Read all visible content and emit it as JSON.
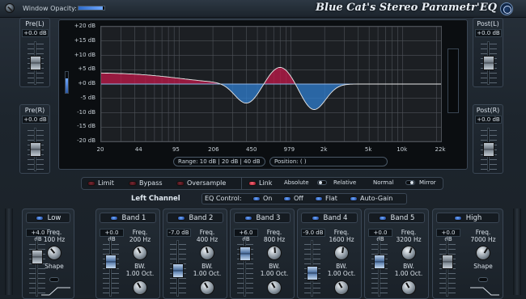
{
  "header": {
    "window_opacity_label": "Window Opacity:",
    "window_opacity_value": 0.95,
    "app_title": "Blue Cat's Stereo Parametr'EQ"
  },
  "pre_l": {
    "title": "Pre(L)",
    "value": "+0.0 dB"
  },
  "pre_r": {
    "title": "Pre(R)",
    "value": "+0.0 dB"
  },
  "post_l": {
    "title": "Post(L)",
    "value": "+0.0 dB"
  },
  "post_r": {
    "title": "Post(R)",
    "value": "+0.0 dB"
  },
  "graph": {
    "y_labels": [
      "+20 dB",
      "+15 dB",
      "+10 dB",
      "+5 dB",
      "+0 dB",
      "-5 dB",
      "-10 dB",
      "-15 dB",
      "-20 dB"
    ],
    "x_labels": [
      "20",
      "44",
      "95",
      "206",
      "450",
      "979",
      "2k",
      "5k",
      "10k",
      "22k"
    ],
    "range_prefix": "Range:",
    "range_options": [
      "10 dB",
      "20 dB",
      "40 dB"
    ],
    "range_text": "Range:  10 dB  |  20 dB  |  40 dB",
    "position_label": "Position:",
    "position_value": "(                              )"
  },
  "options": {
    "limit": "Limit",
    "bypass": "Bypass",
    "oversample": "Oversample",
    "link": "Link",
    "absolute": "Absolute",
    "relative": "Relative",
    "normal": "Normal",
    "mirror": "Mirror"
  },
  "channel": {
    "label": "Left Channel",
    "eq_control_label": "EQ Control:",
    "on": "On",
    "off": "Off",
    "flat": "Flat",
    "auto_gain": "Auto-Gain"
  },
  "bands": [
    {
      "name": "Low",
      "gain": "+4.0 dB",
      "freq_label": "Freq.",
      "freq": "100 Hz",
      "param_label": "Shape",
      "param": ""
    },
    {
      "name": "Band 1",
      "gain": "+0.0 dB",
      "freq_label": "Freq.",
      "freq": "200 Hz",
      "param_label": "BW.",
      "param": "1.00 Oct."
    },
    {
      "name": "Band 2",
      "gain": "-7.0 dB",
      "freq_label": "Freq.",
      "freq": "400 Hz",
      "param_label": "BW.",
      "param": "1.00 Oct."
    },
    {
      "name": "Band 3",
      "gain": "+6.0 dB",
      "freq_label": "Freq.",
      "freq": "800 Hz",
      "param_label": "BW.",
      "param": "1.00 Oct."
    },
    {
      "name": "Band 4",
      "gain": "-9.0 dB",
      "freq_label": "Freq.",
      "freq": "1600 Hz",
      "param_label": "BW.",
      "param": "1.00 Oct."
    },
    {
      "name": "Band 5",
      "gain": "+0.0 dB",
      "freq_label": "Freq.",
      "freq": "3200 Hz",
      "param_label": "BW.",
      "param": "1.00 Oct."
    },
    {
      "name": "High",
      "gain": "+0.0 dB",
      "freq_label": "Freq.",
      "freq": "7000 Hz",
      "param_label": "Shape",
      "param": ""
    }
  ],
  "colors": {
    "accent_red": "#c0184a",
    "accent_blue": "#2f7fd0",
    "background": "#1d252d"
  }
}
